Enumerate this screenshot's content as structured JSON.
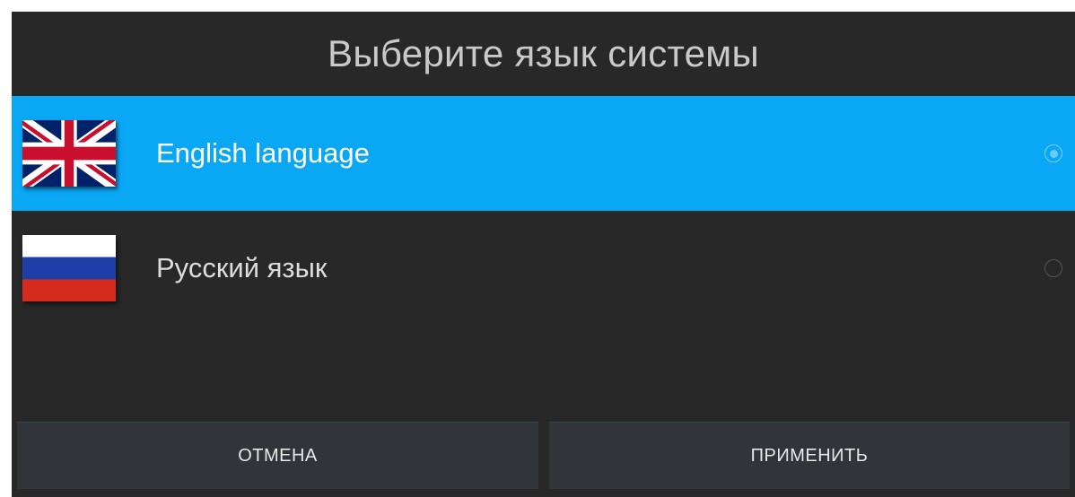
{
  "dialog": {
    "title": "Выберите язык системы"
  },
  "languages": [
    {
      "label": "English language",
      "flag_icon": "uk-flag-icon",
      "selected": true
    },
    {
      "label": "Русский язык",
      "flag_icon": "russia-flag-icon",
      "selected": false
    }
  ],
  "buttons": {
    "cancel_label": "ОТМЕНА",
    "apply_label": "ПРИМЕНИТЬ"
  },
  "colors": {
    "dialog_background": "#282828",
    "selection_highlight": "#0aa7f5",
    "button_background": "#31353a"
  }
}
